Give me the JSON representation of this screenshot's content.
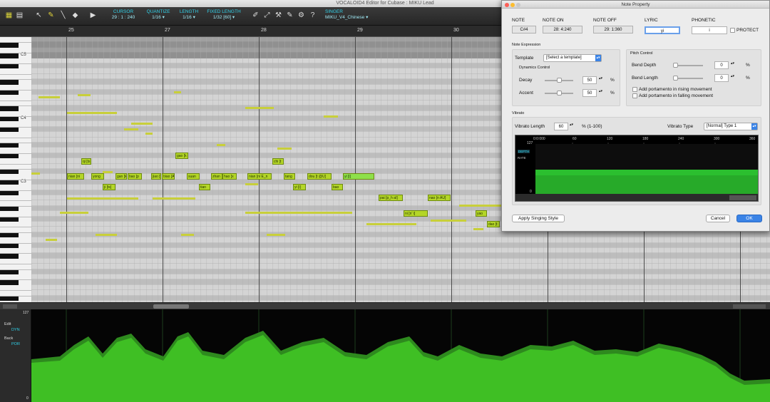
{
  "window": {
    "title": "VOCALOID4 Editor for Cubase : MIKU Lead"
  },
  "toolbar": {
    "cursor": {
      "label": "CURSOR",
      "value": "29 : 1 : 240"
    },
    "quantize": {
      "label": "QUANTIZE",
      "value": "1/16  ▾"
    },
    "length": {
      "label": "LENGTH",
      "value": "1/16  ▾"
    },
    "fixed_length": {
      "label": "FIXED LENGTH",
      "value": "1/32 [60]  ▾"
    },
    "singer": {
      "label": "SINGER",
      "value": "MIKU_V4_Chinese  ▾"
    }
  },
  "ruler": {
    "bars": [
      "25",
      "27",
      "28",
      "29",
      "30"
    ]
  },
  "keys": {
    "octaves": [
      "C5",
      "C4",
      "C3"
    ]
  },
  "notes": [
    {
      "text": "qi [ts",
      "sel": false
    },
    {
      "text": "gao [k",
      "sel": false
    },
    {
      "text": "chi [t",
      "sel": false
    },
    {
      "text": "nian [ni",
      "sel": false
    },
    {
      "text": "yong",
      "sel": false
    },
    {
      "text": "gan [k",
      "sel": false
    },
    {
      "text": "bao [p",
      "sel": false
    },
    {
      "text": "jiao [ts",
      "sel": false
    },
    {
      "text": "biao [AU]",
      "sel": false
    },
    {
      "text": "suan",
      "sel": false
    },
    {
      "text": "zhan",
      "sel": false
    },
    {
      "text": "hao [x",
      "sel": false
    },
    {
      "text": "nian [ni E_n",
      "sel": false
    },
    {
      "text": "tang",
      "sel": false
    },
    {
      "text": "dou [t @U]",
      "sel": false
    },
    {
      "text": "yi [i]",
      "sel": true
    },
    {
      "text": "ji [ts]",
      "sel": false
    },
    {
      "text": "tian",
      "sel": false
    },
    {
      "text": "yi [i]",
      "sel": false
    },
    {
      "text": "bao",
      "sel": false
    },
    {
      "text": "pai [p_h aI]",
      "sel": false
    },
    {
      "text": "nao [n AU]",
      "sel": false
    },
    {
      "text": "ni [n' i]",
      "sel": false
    },
    {
      "text": "yao",
      "sel": false
    },
    {
      "text": "dao [t",
      "sel": false
    }
  ],
  "controls": {
    "edit_label": "Edit",
    "edit_param": "DYN",
    "back_label": "Back",
    "back_param": "POR",
    "max": "127",
    "min": "0"
  },
  "dialog": {
    "title": "Note Property",
    "note_label": "NOTE",
    "note": "C#4",
    "note_on_label": "NOTE ON",
    "note_on": "28: 4:240",
    "note_off_label": "NOTE OFF",
    "note_off": "29: 1:360",
    "lyric_label": "LYRIC",
    "lyric": "yi",
    "phonetic_label": "PHONETIC",
    "phonetic": "i",
    "protect_label": "PROTECT",
    "note_expression_label": "Note Expression",
    "template_label": "Template",
    "template_value": "[Select a template]",
    "dynamics_control_label": "Dynamics Control",
    "decay_label": "Decay",
    "decay_value": "50",
    "decay_unit": "%",
    "accent_label": "Accent",
    "accent_value": "50",
    "accent_unit": "%",
    "pitch_control_label": "Pitch Control",
    "bend_depth_label": "Bend Depth",
    "bend_depth_value": "0",
    "bend_depth_unit": "%",
    "bend_length_label": "Bend Length",
    "bend_length_value": "0",
    "bend_length_unit": "%",
    "portamento_rising_label": "Add portamento in rising movement",
    "portamento_falling_label": "Add portamento in falling movement",
    "vibrato_label": "Vibrato",
    "vibrato_length_label": "Vibrato Length",
    "vibrato_length_value": "60",
    "vibrato_length_range": "% (1-100)",
    "vibrato_type_label": "Vibrato Type",
    "vibrato_type_value": "[Normal] Type 1",
    "graph": {
      "max": "127",
      "min": "0",
      "depth": "DEPTH",
      "rate": "RATE",
      "ticks": [
        "0:0:000",
        "60",
        "120",
        "180",
        "240",
        "300",
        "360"
      ]
    },
    "apply_button": "Apply Singing Style",
    "cancel_button": "Cancel",
    "ok_button": "OK"
  }
}
